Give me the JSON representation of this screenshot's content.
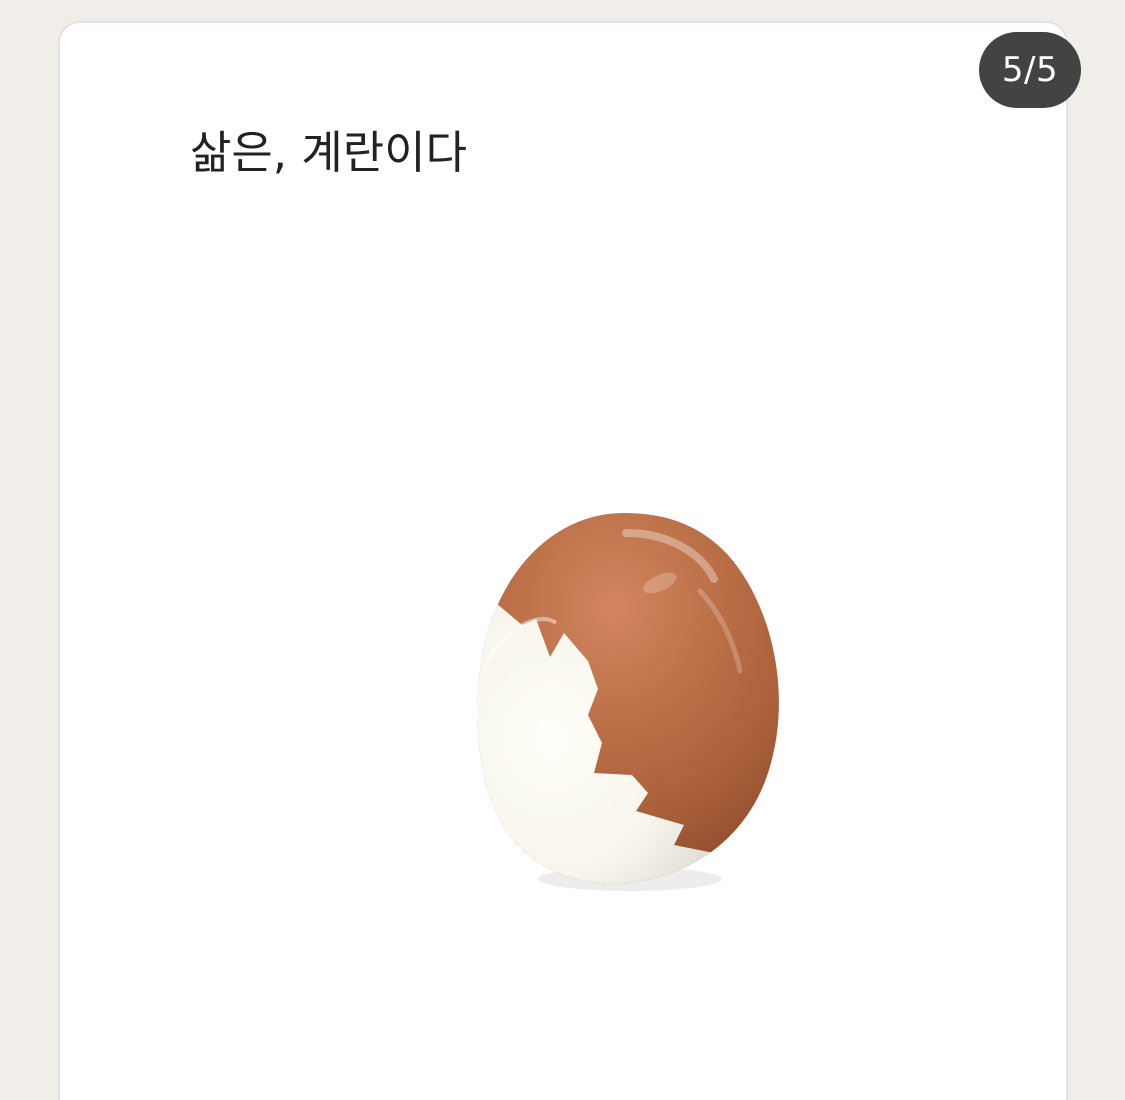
{
  "post": {
    "title": "삶은, 계란이다",
    "page_indicator": "5/5"
  },
  "image": {
    "icon": "boiled-egg-photo",
    "shell_color": "#b56a43",
    "white_color": "#f7f5ec"
  }
}
